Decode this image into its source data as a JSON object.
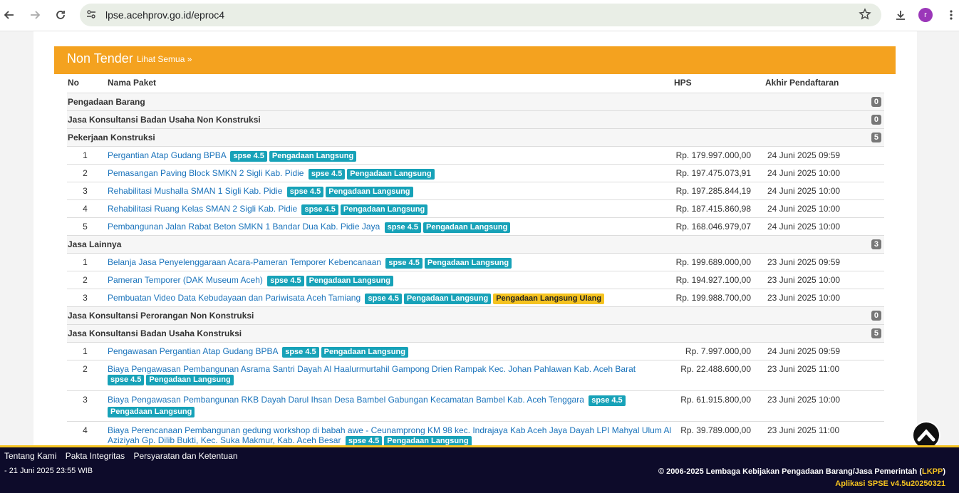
{
  "browser": {
    "url": "lpse.acehprov.go.id/eproc4",
    "avatar_letter": "r"
  },
  "panel": {
    "title": "Non Tender",
    "more_link": "Lihat Semua »"
  },
  "table": {
    "headers": [
      "No",
      "Nama Paket",
      "HPS",
      "Akhir Pendaftaran"
    ],
    "cats": [
      {
        "name": "Pengadaan Barang",
        "count": "0"
      },
      {
        "name": "Jasa Konsultansi Badan Usaha Non Konstruksi",
        "count": "0"
      },
      {
        "name": "Pekerjaan Konstruksi",
        "count": "5"
      },
      {
        "name": "Jasa Lainnya",
        "count": "3"
      },
      {
        "name": "Jasa Konsultansi Perorangan Non Konstruksi",
        "count": "0"
      },
      {
        "name": "Jasa Konsultansi Badan Usaha Konstruksi",
        "count": "5"
      }
    ],
    "rows_konstruksi": [
      {
        "no": "1",
        "name": "Pergantian Atap Gudang BPBA",
        "hps": "Rp. 179.997.000,00",
        "end": "24 Juni 2025 09:59"
      },
      {
        "no": "2",
        "name": "Pemasangan Paving Block SMKN 2 Sigli Kab. Pidie",
        "hps": "Rp. 197.475.073,91",
        "end": "24 Juni 2025 10:00"
      },
      {
        "no": "3",
        "name": "Rehabilitasi Mushalla SMAN 1 Sigli Kab. Pidie",
        "hps": "Rp. 197.285.844,19",
        "end": "24 Juni 2025 10:00"
      },
      {
        "no": "4",
        "name": "Rehabilitasi Ruang Kelas SMAN 2 Sigli Kab. Pidie",
        "hps": "Rp. 187.415.860,98",
        "end": "24 Juni 2025 10:00"
      },
      {
        "no": "5",
        "name": "Pembangunan Jalan Rabat Beton SMKN 1 Bandar Dua Kab. Pidie Jaya",
        "hps": "Rp. 168.046.979,07",
        "end": "24 Juni 2025 10:00"
      }
    ],
    "rows_lainnya": [
      {
        "no": "1",
        "name": "Belanja Jasa Penyelenggaraan Acara-Pameran Temporer Kebencanaan",
        "hps": "Rp. 199.689.000,00",
        "end": "23 Juni 2025 09:59"
      },
      {
        "no": "2",
        "name": "Pameran Temporer (DAK Museum Aceh)",
        "hps": "Rp. 194.927.100,00",
        "end": "23 Juni 2025 10:00"
      },
      {
        "no": "3",
        "name": "Pembuatan Video Data Kebudayaan dan Pariwisata Aceh Tamiang",
        "hps": "Rp. 199.988.700,00",
        "end": "23 Juni 2025 10:00"
      }
    ],
    "rows_konsultansi": [
      {
        "no": "1",
        "name": "Pengawasan Pergantian Atap Gudang BPBA",
        "hps": "Rp. 7.997.000,00",
        "end": "24 Juni 2025 09:59"
      },
      {
        "no": "2",
        "name": "Biaya Pengawasan Pembangunan Asrama Santri Dayah Al Haalurmurtahil Gampong Drien Rampak Kec. Johan Pahlawan Kab. Aceh Barat",
        "hps": "Rp. 22.488.600,00",
        "end": "23 Juni 2025 11:00"
      },
      {
        "no": "3",
        "name": "Biaya Pengawasan Pembangunan RKB Dayah Darul Ihsan Desa Bambel Gabungan Kecamatan Bambel Kab. Aceh Tenggara",
        "hps": "Rp. 61.915.800,00",
        "end": "23 Juni 2025 10:00"
      },
      {
        "no": "4",
        "name": "Biaya Perencanaan Pembangunan gedung workshop di babah awe - Ceunamprong KM 98 kec. Indrajaya Kab Aceh Jaya Dayah LPI Mahyal Ulum Al Aziziyah Gp. Dilib Bukti, Kec. Suka Makmur, Kab. Aceh Besar",
        "hps": "Rp. 39.789.000,00",
        "end": "23 Juni 2025 11:00"
      }
    ],
    "labels": {
      "spse": "spse 4.5",
      "method": "Pengadaan Langsung",
      "retry": "Pengadaan Langsung Ulang"
    }
  },
  "footer": {
    "links": [
      "Tentang Kami",
      "Pakta Integritas",
      "Persyaratan dan Ketentuan"
    ],
    "stamp": "- 21 Juni 2025 23:55 WIB",
    "copyright": "© 2006-2025 Lembaga Kebijakan Pengadaan Barang/Jasa Pemerintah (",
    "copyright_acc": "LKPP",
    "copyright_end": ")",
    "version": "Aplikasi SPSE v4.5u20250321"
  },
  "colors": {
    "panel": "#f4a21f",
    "label_blue": "#17a2b8",
    "label_yellow": "#f5c320",
    "footer": "#0d0b2a"
  }
}
